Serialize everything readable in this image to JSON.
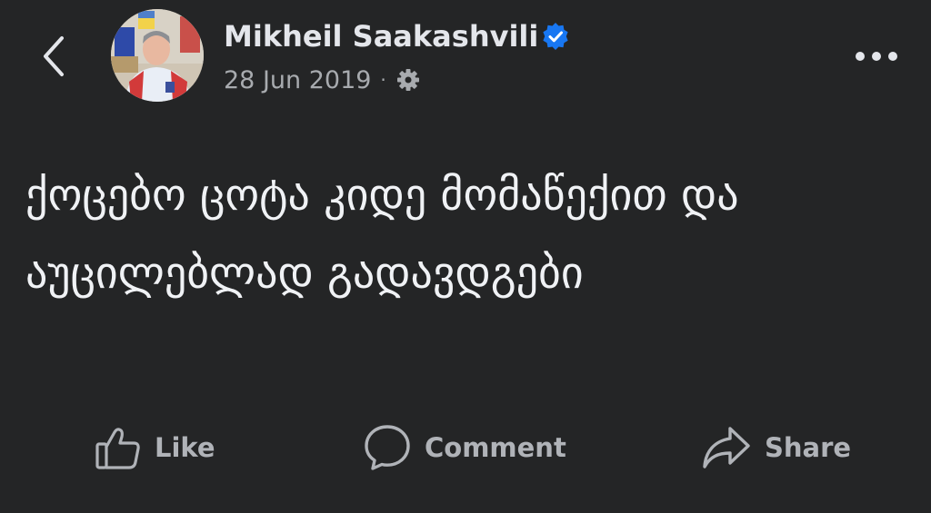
{
  "post": {
    "author": "Mikheil Saakashvili",
    "verified": true,
    "date": "28 Jun 2019",
    "separator": "·",
    "text": "ქოცებო ცოტა კიდე მომაწექით და აუცილებლად გადავდგები"
  },
  "actions": {
    "like_label": "Like",
    "comment_label": "Comment",
    "share_label": "Share"
  },
  "icons": {
    "back": "chevron-left-icon",
    "verified": "verified-badge-icon",
    "privacy": "gear-icon",
    "more": "more-horizontal-icon",
    "like": "thumbs-up-icon",
    "comment": "comment-bubble-icon",
    "share": "share-arrow-icon"
  },
  "colors": {
    "background": "#242526",
    "text_primary": "#e4e6eb",
    "text_secondary": "#a8abaf",
    "verified_blue": "#1877f2"
  }
}
